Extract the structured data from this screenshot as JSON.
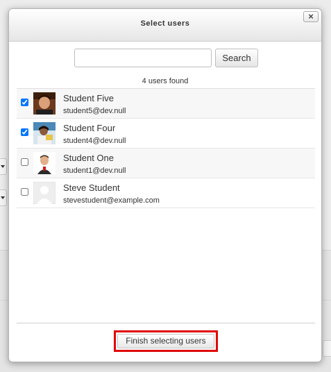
{
  "dialog": {
    "title": "Select users",
    "close_label": "×"
  },
  "search": {
    "value": "",
    "placeholder": "",
    "button_label": "Search"
  },
  "results": {
    "summary": "4 users found"
  },
  "users": [
    {
      "name": "Student Five",
      "email": "student5@dev.null",
      "checked": true,
      "avatar": "photo"
    },
    {
      "name": "Student Four",
      "email": "student4@dev.null",
      "checked": true,
      "avatar": "photo"
    },
    {
      "name": "Student One",
      "email": "student1@dev.null",
      "checked": false,
      "avatar": "photo"
    },
    {
      "name": "Steve Student",
      "email": "stevestudent@example.com",
      "checked": false,
      "avatar": "default-user-icon"
    }
  ],
  "footer": {
    "finish_label": "Finish selecting users"
  },
  "colors": {
    "highlight": "#e00000"
  }
}
